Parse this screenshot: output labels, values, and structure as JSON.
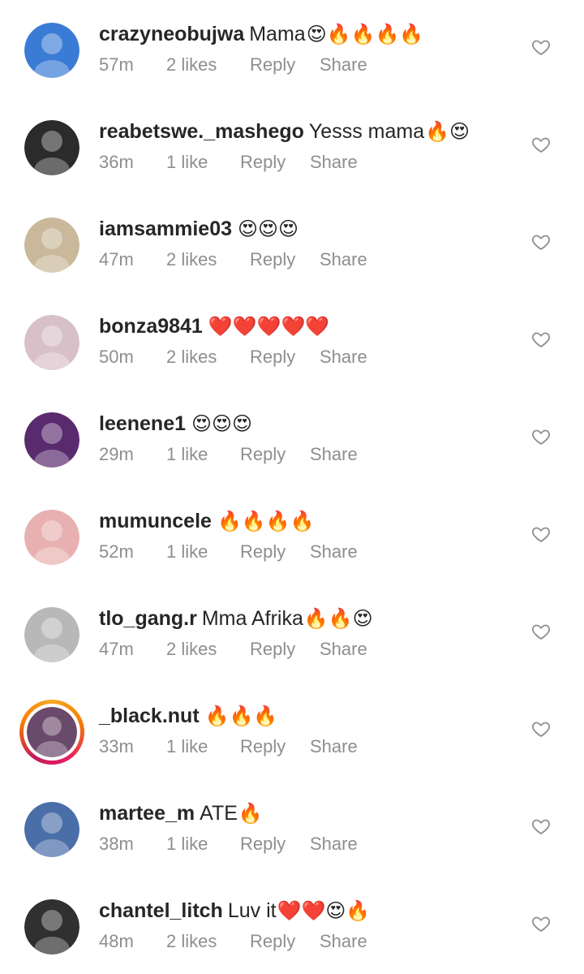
{
  "comments": [
    {
      "username": "crazyneobujwa",
      "text": "Mama",
      "emoji": "😍🔥🔥🔥🔥",
      "time": "57m",
      "likes": "2 likes",
      "reply": "Reply",
      "share": "Share",
      "avatar_color": "#3a7bd5",
      "story": false
    },
    {
      "username": "reabetswe._mashego",
      "text": "Yesss mama",
      "emoji": "🔥😍",
      "time": "36m",
      "likes": "1 like",
      "reply": "Reply",
      "share": "Share",
      "avatar_color": "#2b2b2b",
      "story": false
    },
    {
      "username": "iamsammie03",
      "text": "",
      "emoji": "😍😍😍",
      "time": "47m",
      "likes": "2 likes",
      "reply": "Reply",
      "share": "Share",
      "avatar_color": "#c9b89a",
      "story": false
    },
    {
      "username": "bonza9841",
      "text": "",
      "emoji": "❤️❤️❤️❤️❤️",
      "time": "50m",
      "likes": "2 likes",
      "reply": "Reply",
      "share": "Share",
      "avatar_color": "#d8c0c8",
      "story": false
    },
    {
      "username": "leenene1",
      "text": "",
      "emoji": "😍😍😍",
      "time": "29m",
      "likes": "1 like",
      "reply": "Reply",
      "share": "Share",
      "avatar_color": "#5a2a6e",
      "story": false
    },
    {
      "username": "mumuncele",
      "text": "",
      "emoji": "🔥🔥🔥🔥",
      "time": "52m",
      "likes": "1 like",
      "reply": "Reply",
      "share": "Share",
      "avatar_color": "#e8b0b0",
      "story": false
    },
    {
      "username": "tlo_gang.r",
      "text": "Mma Afrika",
      "emoji": "🔥🔥😍",
      "time": "47m",
      "likes": "2 likes",
      "reply": "Reply",
      "share": "Share",
      "avatar_color": "#b8b8b8",
      "story": false
    },
    {
      "username": "_black.nut",
      "text": "",
      "emoji": "🔥🔥🔥",
      "time": "33m",
      "likes": "1 like",
      "reply": "Reply",
      "share": "Share",
      "avatar_color": "#6a4a6a",
      "story": true
    },
    {
      "username": "martee_m",
      "text": "ATE",
      "emoji": "🔥",
      "time": "38m",
      "likes": "1 like",
      "reply": "Reply",
      "share": "Share",
      "avatar_color": "#4a6ea8",
      "story": false
    },
    {
      "username": "chantel_litch",
      "text": "Luv it",
      "emoji": "❤️❤️😍🔥",
      "time": "48m",
      "likes": "2 likes",
      "reply": "Reply",
      "share": "Share",
      "avatar_color": "#303030",
      "story": false
    }
  ],
  "colors": {
    "primary_text": "#262626",
    "secondary_text": "#8e8e8e",
    "heart_outline": "#8e8e8e"
  },
  "icons": {
    "like": "heart-outline-icon",
    "avatar": "profile-photo"
  }
}
